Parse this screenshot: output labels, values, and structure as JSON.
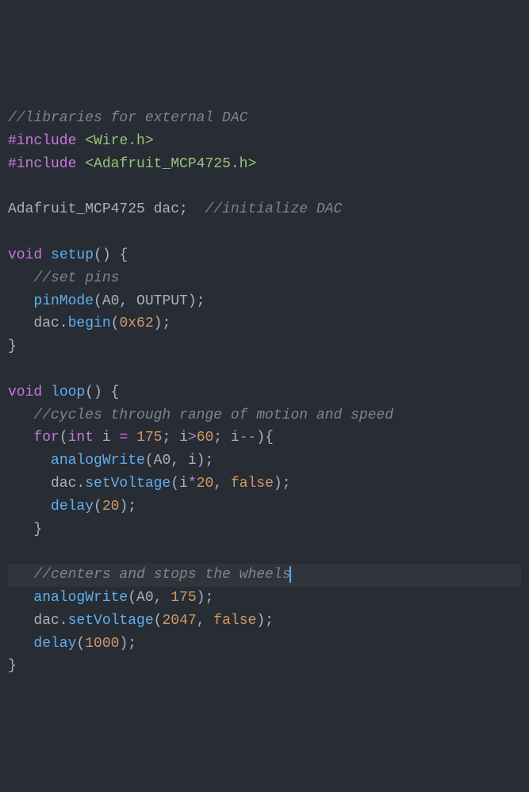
{
  "code": {
    "lines": [
      {
        "tokens": [
          {
            "cls": "comment",
            "text": "//libraries for external DAC"
          }
        ]
      },
      {
        "tokens": [
          {
            "cls": "preproc",
            "text": "#include"
          },
          {
            "cls": "plain",
            "text": " "
          },
          {
            "cls": "string",
            "text": "<Wire.h>"
          }
        ]
      },
      {
        "tokens": [
          {
            "cls": "preproc",
            "text": "#include"
          },
          {
            "cls": "plain",
            "text": " "
          },
          {
            "cls": "string",
            "text": "<Adafruit_MCP4725.h>"
          }
        ]
      },
      {
        "tokens": []
      },
      {
        "tokens": [
          {
            "cls": "type",
            "text": "Adafruit_MCP4725 dac"
          },
          {
            "cls": "punct",
            "text": ";  "
          },
          {
            "cls": "comment",
            "text": "//initialize DAC"
          }
        ]
      },
      {
        "tokens": []
      },
      {
        "tokens": [
          {
            "cls": "keyword",
            "text": "void"
          },
          {
            "cls": "plain",
            "text": " "
          },
          {
            "cls": "func",
            "text": "setup"
          },
          {
            "cls": "punct",
            "text": "() {"
          }
        ]
      },
      {
        "tokens": [
          {
            "cls": "plain",
            "text": "   "
          },
          {
            "cls": "comment",
            "text": "//set pins"
          }
        ]
      },
      {
        "tokens": [
          {
            "cls": "plain",
            "text": "   "
          },
          {
            "cls": "func",
            "text": "pinMode"
          },
          {
            "cls": "punct",
            "text": "(A0, OUTPUT);"
          }
        ]
      },
      {
        "tokens": [
          {
            "cls": "plain",
            "text": "   dac."
          },
          {
            "cls": "func",
            "text": "begin"
          },
          {
            "cls": "punct",
            "text": "("
          },
          {
            "cls": "num",
            "text": "0x62"
          },
          {
            "cls": "punct",
            "text": ");"
          }
        ]
      },
      {
        "tokens": [
          {
            "cls": "punct",
            "text": "}"
          }
        ]
      },
      {
        "tokens": []
      },
      {
        "tokens": [
          {
            "cls": "keyword",
            "text": "void"
          },
          {
            "cls": "plain",
            "text": " "
          },
          {
            "cls": "func",
            "text": "loop"
          },
          {
            "cls": "punct",
            "text": "() {"
          }
        ]
      },
      {
        "tokens": [
          {
            "cls": "plain",
            "text": "   "
          },
          {
            "cls": "comment",
            "text": "//cycles through range of motion and speed"
          }
        ]
      },
      {
        "tokens": [
          {
            "cls": "plain",
            "text": "   "
          },
          {
            "cls": "keyword",
            "text": "for"
          },
          {
            "cls": "punct",
            "text": "("
          },
          {
            "cls": "keyword",
            "text": "int"
          },
          {
            "cls": "plain",
            "text": " i "
          },
          {
            "cls": "op",
            "text": "="
          },
          {
            "cls": "plain",
            "text": " "
          },
          {
            "cls": "num",
            "text": "175"
          },
          {
            "cls": "punct",
            "text": "; i"
          },
          {
            "cls": "op",
            "text": ">"
          },
          {
            "cls": "num",
            "text": "60"
          },
          {
            "cls": "punct",
            "text": "; i"
          },
          {
            "cls": "op",
            "text": "--"
          },
          {
            "cls": "punct",
            "text": "){"
          }
        ]
      },
      {
        "tokens": [
          {
            "cls": "plain",
            "text": "     "
          },
          {
            "cls": "func",
            "text": "analogWrite"
          },
          {
            "cls": "punct",
            "text": "(A0, i);"
          }
        ]
      },
      {
        "tokens": [
          {
            "cls": "plain",
            "text": "     dac."
          },
          {
            "cls": "func",
            "text": "setVoltage"
          },
          {
            "cls": "punct",
            "text": "(i"
          },
          {
            "cls": "op",
            "text": "*"
          },
          {
            "cls": "num",
            "text": "20"
          },
          {
            "cls": "punct",
            "text": ", "
          },
          {
            "cls": "const",
            "text": "false"
          },
          {
            "cls": "punct",
            "text": ");"
          }
        ]
      },
      {
        "tokens": [
          {
            "cls": "plain",
            "text": "     "
          },
          {
            "cls": "func",
            "text": "delay"
          },
          {
            "cls": "punct",
            "text": "("
          },
          {
            "cls": "num",
            "text": "20"
          },
          {
            "cls": "punct",
            "text": ");"
          }
        ]
      },
      {
        "tokens": [
          {
            "cls": "punct",
            "text": "   }"
          }
        ]
      },
      {
        "tokens": []
      },
      {
        "highlighted": true,
        "cursor_after": true,
        "tokens": [
          {
            "cls": "plain",
            "text": "   "
          },
          {
            "cls": "comment",
            "text": "//centers and stops the wheels"
          }
        ]
      },
      {
        "tokens": [
          {
            "cls": "plain",
            "text": "   "
          },
          {
            "cls": "func",
            "text": "analogWrite"
          },
          {
            "cls": "punct",
            "text": "(A0, "
          },
          {
            "cls": "num",
            "text": "175"
          },
          {
            "cls": "punct",
            "text": ");"
          }
        ]
      },
      {
        "tokens": [
          {
            "cls": "plain",
            "text": "   dac."
          },
          {
            "cls": "func",
            "text": "setVoltage"
          },
          {
            "cls": "punct",
            "text": "("
          },
          {
            "cls": "num",
            "text": "2047"
          },
          {
            "cls": "punct",
            "text": ", "
          },
          {
            "cls": "const",
            "text": "false"
          },
          {
            "cls": "punct",
            "text": ");"
          }
        ]
      },
      {
        "tokens": [
          {
            "cls": "plain",
            "text": "   "
          },
          {
            "cls": "func",
            "text": "delay"
          },
          {
            "cls": "punct",
            "text": "("
          },
          {
            "cls": "num",
            "text": "1000"
          },
          {
            "cls": "punct",
            "text": ");"
          }
        ]
      },
      {
        "tokens": [
          {
            "cls": "punct",
            "text": "}"
          }
        ]
      }
    ]
  }
}
